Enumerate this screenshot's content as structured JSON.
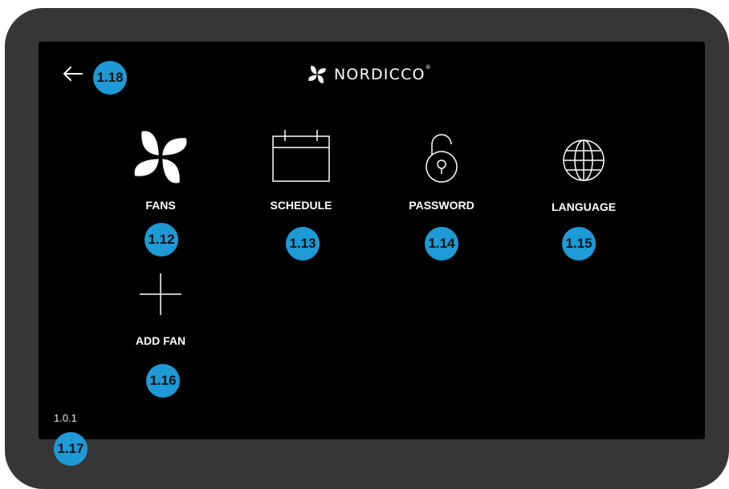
{
  "brand": {
    "name": "NORDICCO",
    "registered_mark": "®"
  },
  "icons": {
    "back": "arrow-left-icon",
    "brand": "nordicco-fan-logo-icon",
    "fans": "fan-pinwheel-icon",
    "schedule": "calendar-icon",
    "password": "padlock-open-icon",
    "language": "globe-icon",
    "add_fan": "plus-icon"
  },
  "menu": {
    "fans": "FANS",
    "schedule": "SCHEDULE",
    "password": "PASSWORD",
    "language": "LANGUAGE",
    "add_fan": "ADD FAN"
  },
  "version": "1.0.1",
  "annotations": {
    "back": "1.18",
    "fans": "1.12",
    "schedule": "1.13",
    "password": "1.14",
    "language": "1.15",
    "add_fan": "1.16",
    "version": "1.17"
  },
  "colors": {
    "screen": "#000000",
    "bezel": "#363636",
    "text": "#ffffff",
    "badge": "#1e9ad6"
  }
}
